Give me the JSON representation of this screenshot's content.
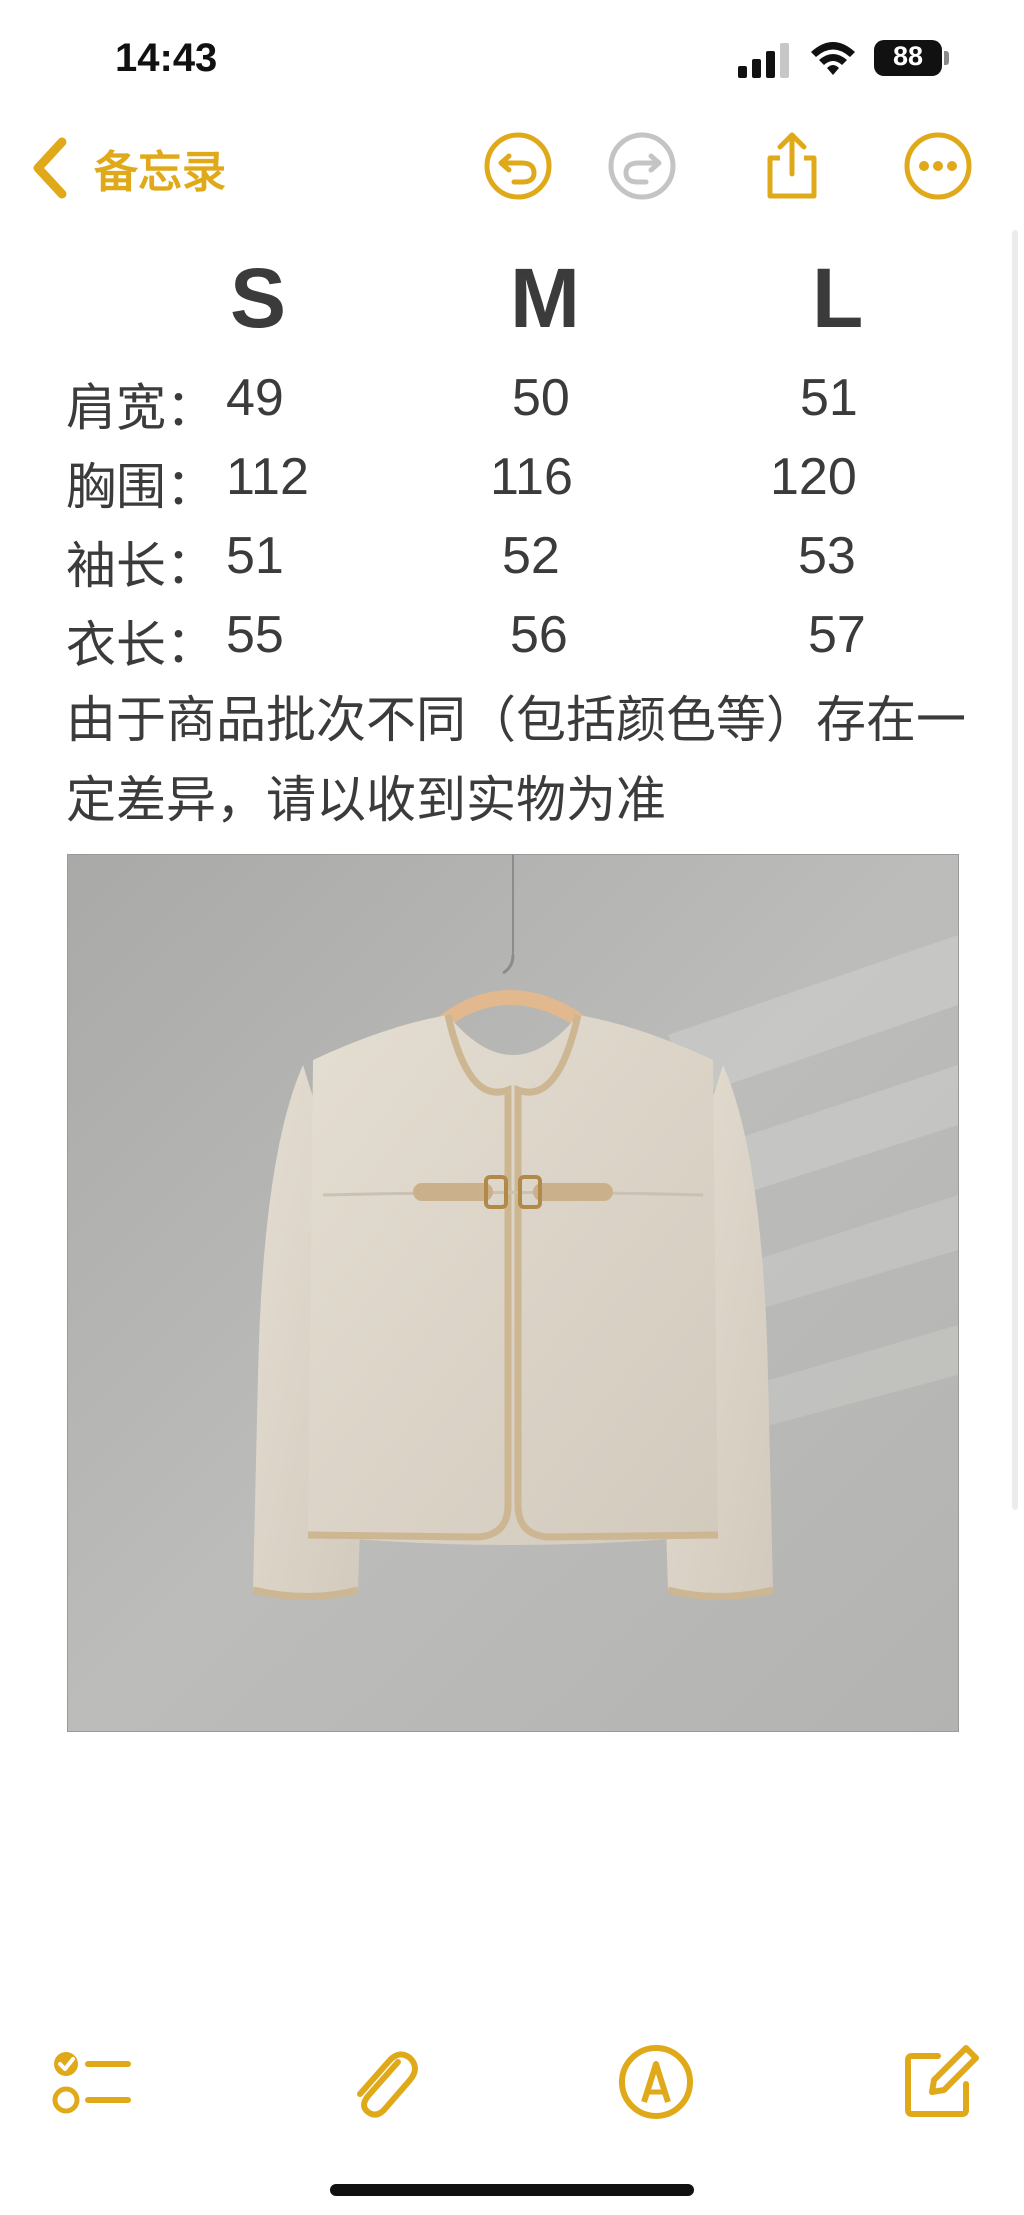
{
  "status_bar": {
    "time": "14:43",
    "battery_level": "88",
    "signal_icon": "cellular-signal-icon",
    "wifi_icon": "wifi-icon",
    "battery_icon": "battery-icon"
  },
  "nav": {
    "back_label": "备忘录",
    "back_icon": "chevron-left-icon",
    "undo_icon": "undo-icon",
    "redo_icon": "redo-icon",
    "share_icon": "share-icon",
    "more_icon": "more-icon",
    "accent_color": "#e0a91a",
    "disabled_color": "#c4c4c4"
  },
  "size_chart": {
    "headers": [
      "S",
      "M",
      "L"
    ],
    "rows": [
      {
        "label": "肩宽：",
        "values": [
          "49",
          "50",
          "51"
        ]
      },
      {
        "label": "胸围：",
        "values": [
          "112",
          "116",
          "120"
        ]
      },
      {
        "label": "袖长：",
        "values": [
          "51",
          "52",
          "53"
        ]
      },
      {
        "label": "衣长：",
        "values": [
          "55",
          "56",
          "57"
        ]
      }
    ]
  },
  "note": {
    "disclaimer": "由于商品批次不同（包括颜色等）存在一定差异，请以收到实物为准"
  },
  "product_image": {
    "subject": "beige wool cardigan jacket with leather buckle closure on wooden hanger",
    "background_color": "#b9b9b7",
    "garment_color": "#ddd6c9",
    "trim_color": "#cdb692"
  },
  "toolbar": {
    "checklist_icon": "checklist-icon",
    "attachment_icon": "paperclip-icon",
    "markup_icon": "markup-pen-icon",
    "compose_icon": "compose-icon"
  }
}
